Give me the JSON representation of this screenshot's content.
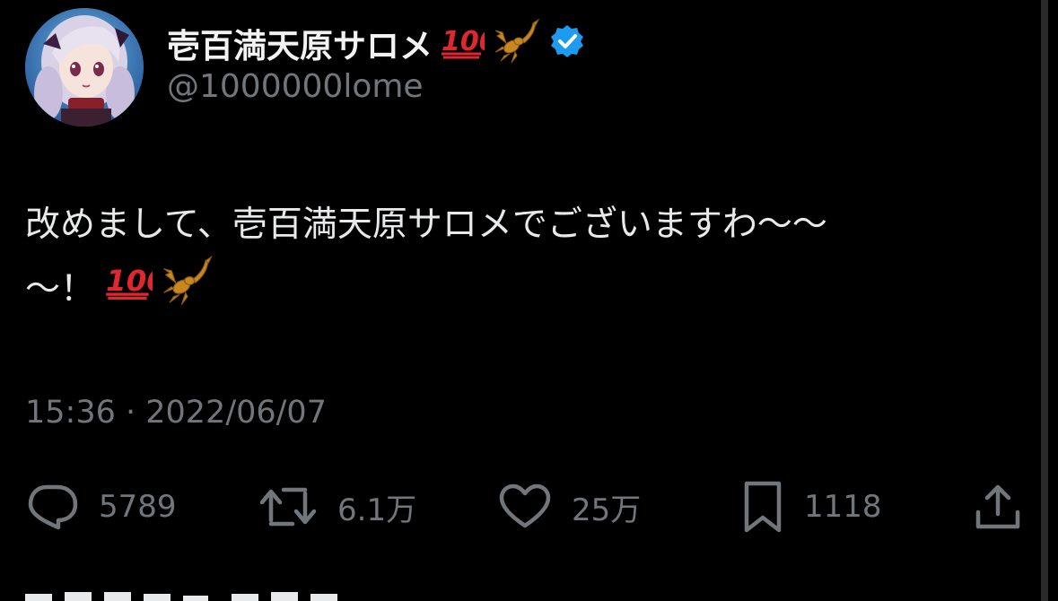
{
  "user": {
    "display_name": "壱百満天原サロメ",
    "handle": "@1000000lome",
    "verified": true,
    "emojis": [
      "hundred-points-emoji",
      "scorpion-emoji"
    ]
  },
  "tweet": {
    "line1": "改めまして、壱百満天原サロメでございますわ〜〜",
    "line2": "〜！",
    "timestamp": "15:36 · 2022/06/07"
  },
  "actions": {
    "replies": "5789",
    "retweets": "6.1万",
    "likes": "25万",
    "bookmarks": "1118"
  },
  "colors": {
    "background": "#000000",
    "text": "#e7e9ea",
    "muted": "#71767b",
    "verified": "#1d9bf0",
    "hundred": "#e0262f",
    "scorpion": "#c8871f"
  }
}
